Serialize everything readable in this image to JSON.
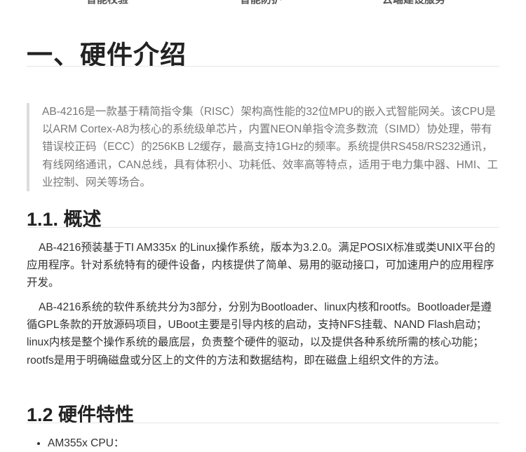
{
  "topnav": {
    "items": [
      "智能校验",
      "智能防护",
      "云端建设服务"
    ]
  },
  "section1": {
    "title": "一、硬件介绍",
    "quote": "AB-4216是一款基于精简指令集（RISC）架构高性能的32位MPU的嵌入式智能网关。该CPU是以ARM Cortex-A8为核心的系统级单芯片，内置NEON单指令流多数流（SIMD）协处理，带有错误校正码（ECC）的256KB L2缓存，最高支持1GHz的频率。系统提供RS458/RS232通讯，有线网络通讯，CAN总线，具有体积小、功耗低、效率高等特点，适用于电力集中器、HMI、工业控制、网关等场合。"
  },
  "overview": {
    "title": "1.1. 概述",
    "para1": "AB-4216预装基于TI AM335x 的Linux操作系统，版本为3.2.0。满足POSIX标准或类UNIX平台的应用程序。针对系统特有的硬件设备，内核提供了简单、易用的驱动接口，可加速用户的应用程序开发。",
    "para2": "AB-4216系统的软件系统共分为3部分，分别为Bootloader、linux内核和rootfs。Bootloader是遵循GPL条款的开放源码项目，UBoot主要是引导内核的启动，支持NFS挂载、NAND Flash启动；linux内核是整个操作系统的最底层，负责整个硬件的驱动，以及提供各种系统所需的核心功能；rootfs是用于明确磁盘或分区上的文件的方法和数据结构，即在磁盘上组织文件的方法。"
  },
  "features": {
    "title": "1.2 硬件特性",
    "items": [
      "AM355x CPU："
    ]
  }
}
